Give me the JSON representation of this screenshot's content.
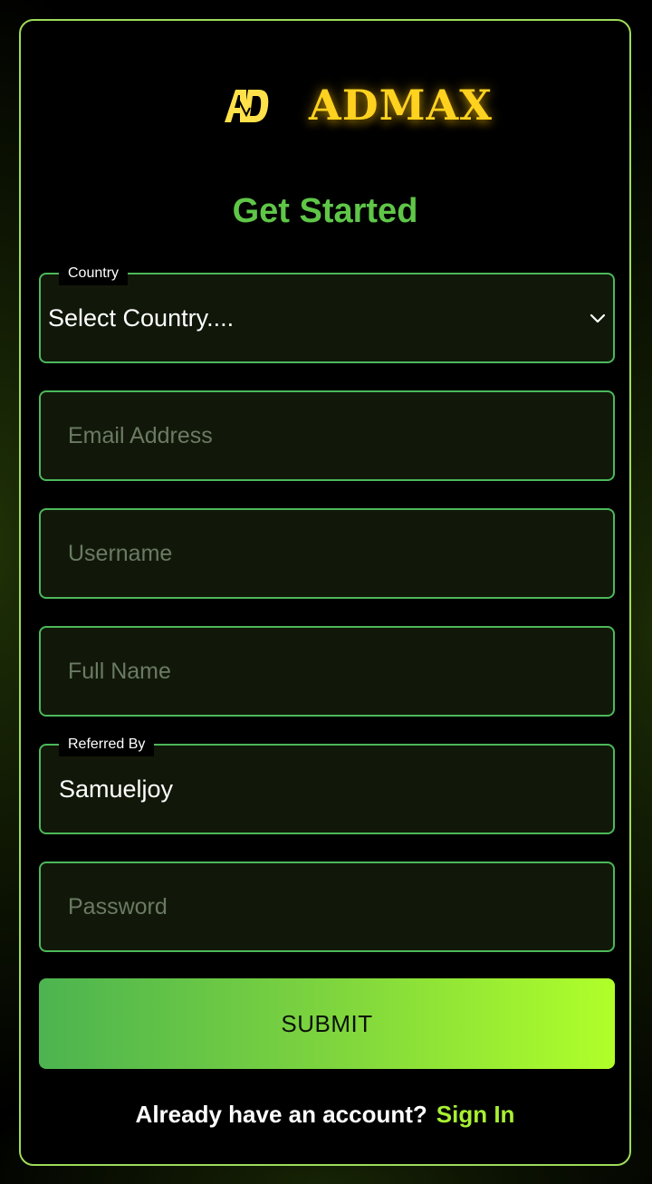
{
  "brand": {
    "name": "ADMAX",
    "mark": "AD"
  },
  "title": "Get Started",
  "form": {
    "country": {
      "label": "Country",
      "value": "Select Country...."
    },
    "email": {
      "placeholder": "Email Address"
    },
    "username": {
      "placeholder": "Username"
    },
    "full_name": {
      "placeholder": "Full Name"
    },
    "referred_by": {
      "label": "Referred By",
      "value": "Samueljoy"
    },
    "password": {
      "placeholder": "Password"
    },
    "submit_label": "SUBMIT"
  },
  "footer": {
    "question": "Already have an account?",
    "link": "Sign In"
  },
  "colors": {
    "accent_green": "#5fc648",
    "border_green": "#4cb85a",
    "brand_gold": "#ffd21f",
    "link_lime": "#a8f032"
  }
}
